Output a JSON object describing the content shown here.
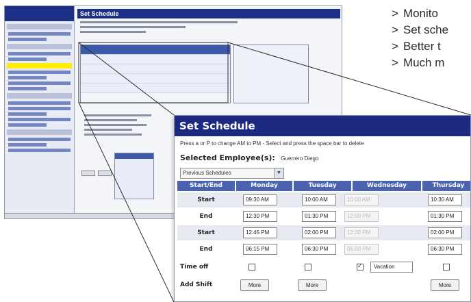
{
  "bullets": [
    {
      "marker": ">",
      "text": "Monito"
    },
    {
      "marker": ">",
      "text": "Set sche"
    },
    {
      "marker": ">",
      "text": "Better t"
    },
    {
      "marker": ">",
      "text": "Much m"
    }
  ],
  "mini_screen": {
    "title": "Set Schedule"
  },
  "schedule": {
    "title": "Set Schedule",
    "hint": "Press a or P to change AM to PM - Select and press the space bar to delete",
    "employee_label": "Selected Employee(s):",
    "employee_value": "Guerrero Diego",
    "previous_select": {
      "value": "Previous Schedules",
      "arrow": "▼"
    },
    "headers": [
      "Start/End",
      "Monday",
      "Tuesday",
      "Wednesday",
      "Thursday"
    ],
    "rows": [
      {
        "label": "Start",
        "times": [
          "09:30 AM",
          "10:00 AM",
          "10:00 AM",
          "10:30 AM"
        ]
      },
      {
        "label": "End",
        "times": [
          "12:30 PM",
          "01:30 PM",
          "12:00 PM",
          "01:30 PM"
        ]
      },
      {
        "label": "Start",
        "times": [
          "12:45 PM",
          "02:00 PM",
          "12:30 PM",
          "02:00 PM"
        ]
      },
      {
        "label": "End",
        "times": [
          "06:15 PM",
          "06:30 PM",
          "05:00 PM",
          "06:30 PM"
        ]
      }
    ],
    "time_off": {
      "label": "Time off",
      "vacation": "Vacation"
    },
    "add_shift": {
      "label": "Add Shift",
      "button": "More"
    }
  }
}
